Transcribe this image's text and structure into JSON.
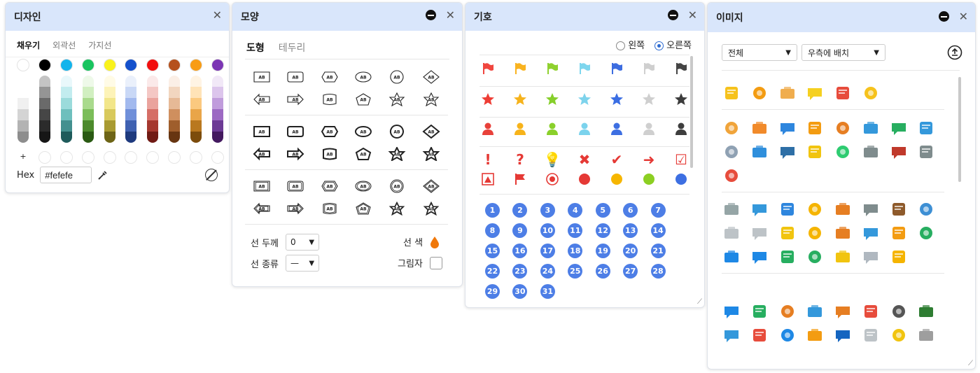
{
  "design": {
    "title": "디자인",
    "close": "✕",
    "tabs": [
      "채우기",
      "외곽선",
      "가지선"
    ],
    "palette": [
      {
        "dot": "#ffffff",
        "bar": [
          "#f0f0f0",
          "#d4d4d4",
          "#b3b3b3",
          "#8d8d8d"
        ]
      },
      {
        "dot": "#000000",
        "bar": [
          "#c4c4c4",
          "#959595",
          "#6a6a6a",
          "#464646",
          "#2b2b2b",
          "#161616"
        ]
      },
      {
        "dot": "#13b4ec",
        "bar": [
          "#e9f8fb",
          "#c2ecef",
          "#9bdbdb",
          "#6ebfbd",
          "#43908f",
          "#1e5b5b"
        ]
      },
      {
        "dot": "#19c45f",
        "bar": [
          "#eef9e9",
          "#d1efc1",
          "#a9da8d",
          "#7bbd59",
          "#4c8a2c",
          "#2a5a13"
        ]
      },
      {
        "dot": "#f9f21c",
        "bar": [
          "#fffbe6",
          "#fdf3b8",
          "#f2e68a",
          "#d8c95c",
          "#a89a31",
          "#6d6416"
        ]
      },
      {
        "dot": "#1450cc",
        "bar": [
          "#eaf0fb",
          "#c9d8f6",
          "#a2b9ee",
          "#6f8fd9",
          "#3f61b1",
          "#1e3a7e"
        ]
      },
      {
        "dot": "#f20f0f",
        "bar": [
          "#fbe9e9",
          "#f4c7c4",
          "#eaa39d",
          "#d56e66",
          "#a5382f",
          "#701a14"
        ]
      },
      {
        "dot": "#b5501c",
        "bar": [
          "#fbefe6",
          "#f2d6bf",
          "#e6b996",
          "#cf8f5e",
          "#9f5e2c",
          "#673511"
        ]
      },
      {
        "dot": "#f89c14",
        "bar": [
          "#fff4e4",
          "#ffe3b7",
          "#fbc97f",
          "#e9a548",
          "#b9781f",
          "#7c4c0c"
        ]
      },
      {
        "dot": "#7b35b4",
        "bar": [
          "#f1e8f7",
          "#dcc5ec",
          "#c09cdc",
          "#9c69c3",
          "#6c3a95",
          "#43195f"
        ]
      }
    ],
    "custom_plus": "+",
    "hex_label": "Hex",
    "hex_value": "#fefefe"
  },
  "shape": {
    "title": "모양",
    "tabs": [
      "도형",
      "테두리"
    ],
    "line_width_label": "선 두께",
    "line_width_value": "0",
    "line_type_label": "선 종류",
    "line_type_value": "—",
    "line_color_label": "선 색",
    "shadow_label": "그림자",
    "shape_text": "AB"
  },
  "symbol": {
    "title": "기호",
    "radio_left": "왼쪽",
    "radio_right": "오른쪽",
    "accent": "#2d6bd1",
    "flag_colors": [
      "#f0463f",
      "#f9b320",
      "#8fd12f",
      "#7ed6ee",
      "#3d6de0",
      "#cfcfcf",
      "#444444"
    ],
    "star_colors": [
      "#ee3d35",
      "#f6b31c",
      "#86cf2b",
      "#7ed3ec",
      "#3b6ee3",
      "#cfcfcf",
      "#3c3c3c"
    ],
    "person_colors": [
      "#e8413a",
      "#f7b31a",
      "#8ad02b",
      "#7bd3ed",
      "#3d6fe2",
      "#cfcfcf",
      "#3d3d3d"
    ],
    "misc1": [
      "!",
      "?",
      "💡",
      "✖",
      "✔",
      "➜",
      "☑"
    ],
    "misc1_colors": [
      "#e53935",
      "#e53935",
      "#f0a000",
      "#e53935",
      "#e53935",
      "#e53935",
      "#e53935"
    ],
    "misc2_colors": [
      "#e53935",
      "#e53935",
      "#e53935",
      "#e53935",
      "#f6b600",
      "#8ccf22",
      "#3d6fe2"
    ],
    "numbers": [
      "1",
      "2",
      "3",
      "4",
      "5",
      "6",
      "7",
      "8",
      "9",
      "10",
      "11",
      "12",
      "13",
      "14",
      "15",
      "16",
      "17",
      "18",
      "19",
      "20",
      "21",
      "22",
      "23",
      "24",
      "25",
      "26",
      "27",
      "28",
      "29",
      "30",
      "31"
    ]
  },
  "image": {
    "title": "이미지",
    "filter_value": "전체",
    "position_value": "우측에 배치",
    "groups": [
      [
        "#f6c21c",
        "#f39c12",
        "#f0ad4e",
        "#f5d020",
        "#e74c3c",
        "#f6c21c"
      ],
      [
        "#f0a43a",
        "#f18a2a",
        "#2e86de",
        "#f39c12",
        "#e67e22",
        "#3498db",
        "#27ae60",
        "#3498db",
        "#8fa1b3",
        "#2f8fdc",
        "#2e6fa6",
        "#f1c40f",
        "#2ecc71",
        "#7f8c8d",
        "#c0392b",
        "#7f8c8d",
        "#e74c3c"
      ],
      [
        "#95a5a6",
        "#3498db",
        "#2e86de",
        "#f5b400",
        "#e67e22",
        "#7f8c8d",
        "#8e5a2b",
        "#3d8fd4",
        "#bdc3c7",
        "#bdc3c7",
        "#f1c40f",
        "#f5b400",
        "#e67e22",
        "#3498db",
        "#f39c12",
        "#27ae60",
        "#1e88e5",
        "#1e88e5",
        "#27ae60",
        "#27ae60",
        "#f1c40f",
        "#b0b8c0",
        "#f5b400"
      ],
      [
        "#1e88e5",
        "#27ae60",
        "#e67e22",
        "#3498db",
        "#e67e22",
        "#e74c3c",
        "#555555",
        "#2e7d32",
        "#3498db",
        "#e74c3c",
        "#1e88e5",
        "#f39c12",
        "#1565c0",
        "#bdc3c7",
        "#f1c40f",
        "#9e9e9e"
      ]
    ]
  }
}
